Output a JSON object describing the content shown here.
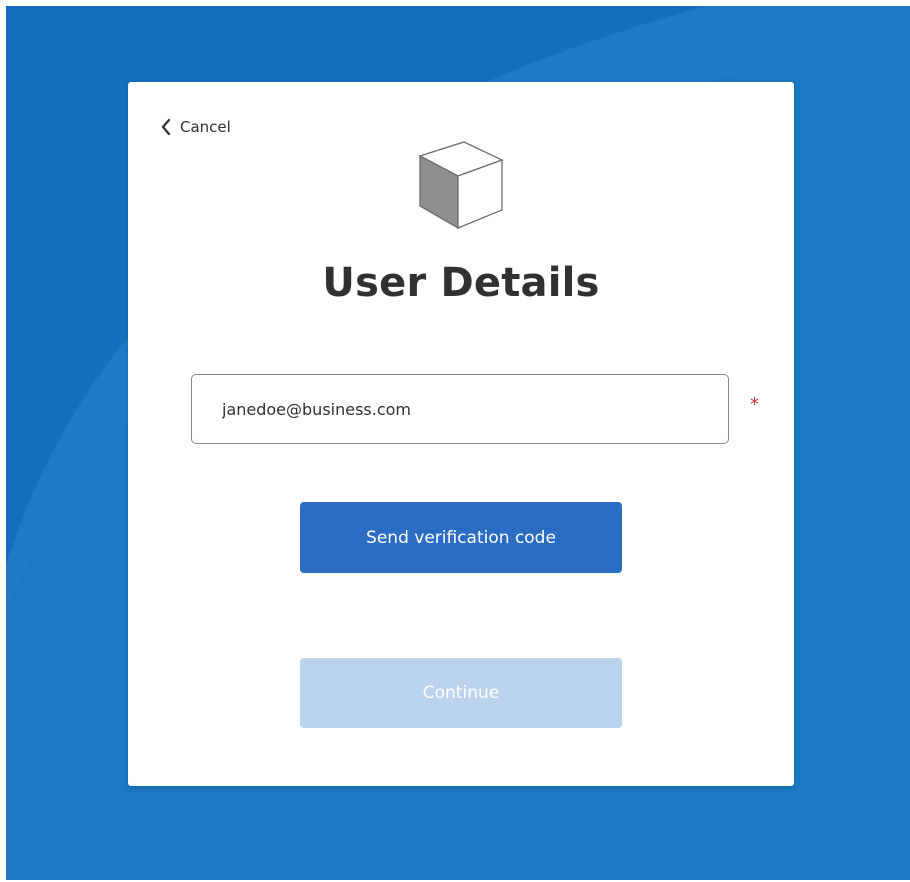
{
  "header": {
    "cancel_label": "Cancel",
    "title": "User Details"
  },
  "form": {
    "email_value": "janedoe@business.com",
    "required_marker": "*"
  },
  "actions": {
    "send_code_label": "Send verification code",
    "continue_label": "Continue"
  },
  "icons": {
    "back": "chevron-left-icon",
    "logo": "cube-logo-icon"
  },
  "colors": {
    "background": "#1470bf",
    "primary_button": "#2b6cc4",
    "disabled_button": "#bcd3ee",
    "required": "#d13438"
  }
}
